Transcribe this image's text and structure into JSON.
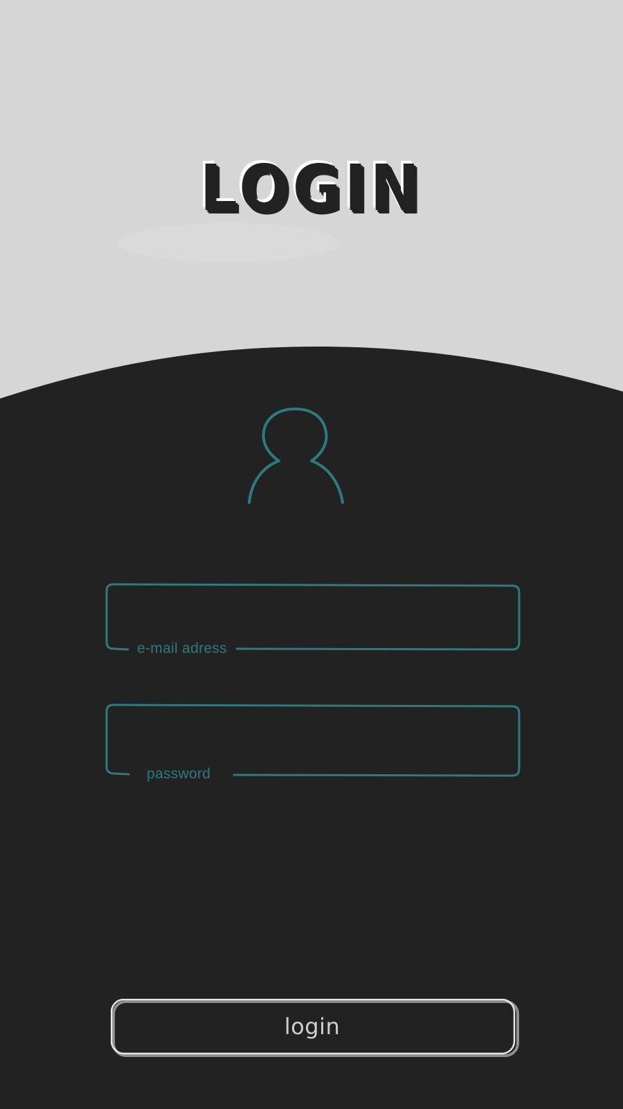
{
  "title": "LOGIN",
  "form": {
    "email_label": "e-mail adress",
    "password_label": "password",
    "login_button_label": "login"
  },
  "icons": {
    "avatar": "user-icon"
  },
  "colors": {
    "background_light": "#d6d6d6",
    "panel_dark": "#222222",
    "accent_teal": "#2b7b80",
    "button_outline": "#e6e6e6"
  }
}
